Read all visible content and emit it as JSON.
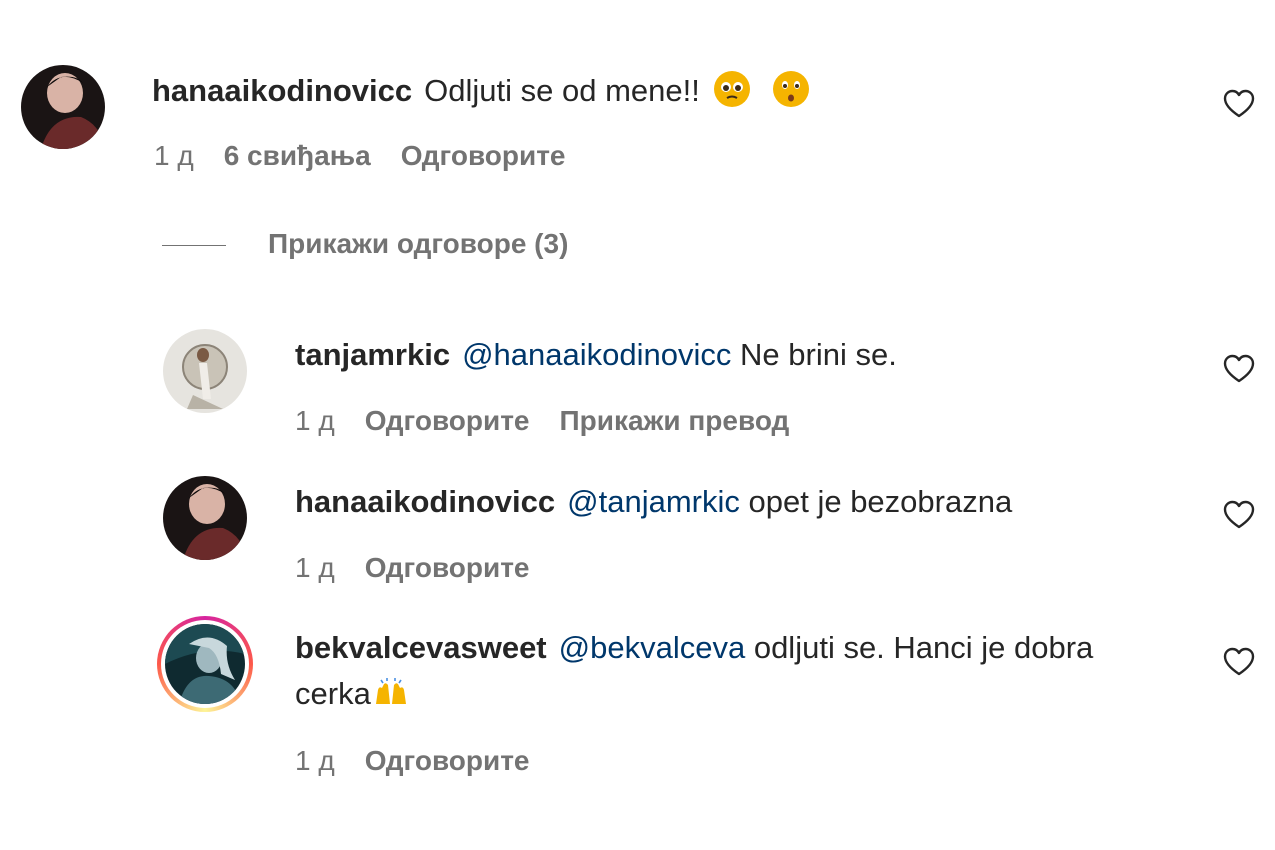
{
  "top_partial_text": "",
  "comments": [
    {
      "username": "hanaaikodinovicc",
      "mention": "",
      "text": "Odljuti se od mene!!",
      "time": "1 д",
      "likes": "6 свиђања",
      "reply_label": "Одговорите",
      "translate_label": ""
    }
  ],
  "view_replies": "Прикажи одговоре (3)",
  "replies": [
    {
      "username": "tanjamrkic",
      "mention": "@hanaaikodinovicc",
      "text": "Ne brini se.",
      "time": "1 д",
      "reply_label": "Одговорите",
      "translate_label": "Прикажи превод"
    },
    {
      "username": "hanaaikodinovicc",
      "mention": "@tanjamrkic",
      "text": "opet je bezobrazna",
      "time": "1 д",
      "reply_label": "Одговорите"
    },
    {
      "username": "bekvalcevasweet",
      "mention": "@bekvalceva",
      "text": "odljuti se. Hanci je dobra cerka",
      "time": "1 д",
      "reply_label": "Одговорите"
    }
  ],
  "icons": {
    "like": "heart-icon",
    "emoji_1": "pleading-face-emoji",
    "emoji_2": "kissing-face-emoji",
    "emoji_3": "raising-hands-emoji"
  },
  "colors": {
    "text": "#262626",
    "secondary": "#737373",
    "mention": "#00376b",
    "emoji": "#f5b400"
  }
}
